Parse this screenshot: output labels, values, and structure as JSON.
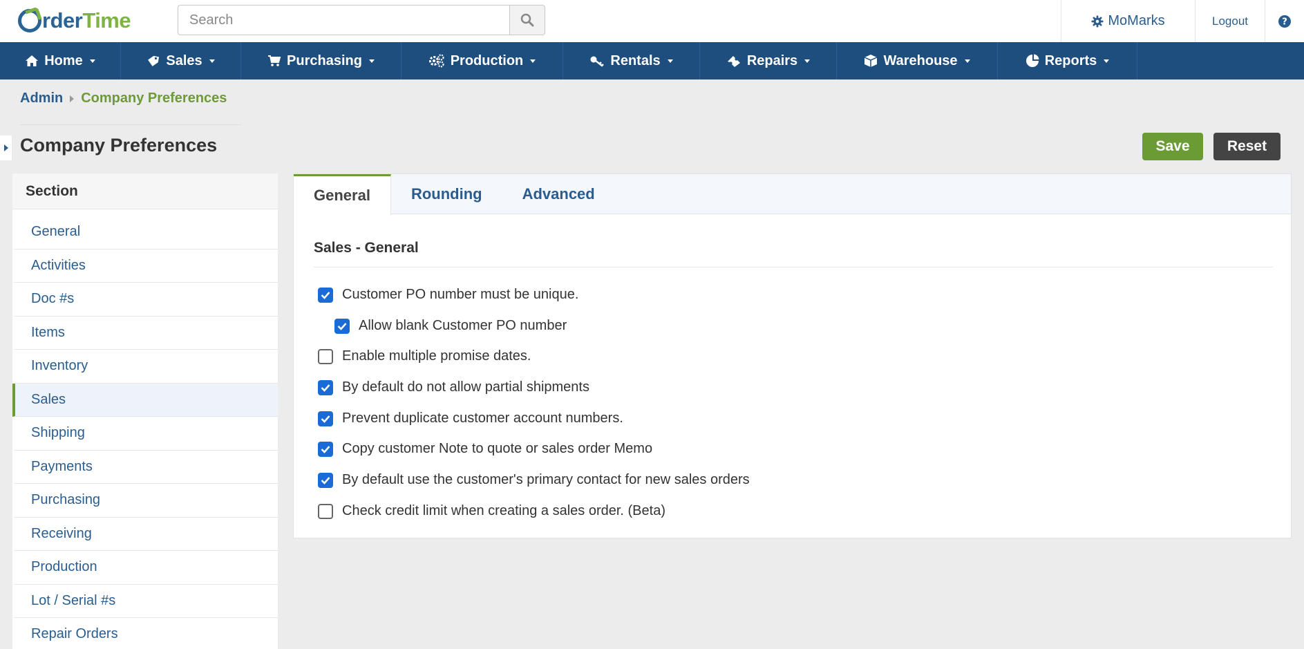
{
  "header": {
    "logo_part1": "O",
    "logo_part2": "rder",
    "logo_part3": "Time",
    "search_placeholder": "Search",
    "user_label": "MoMarks",
    "logout_label": "Logout"
  },
  "nav": [
    {
      "label": "Home",
      "icon": "home-icon"
    },
    {
      "label": "Sales",
      "icon": "tag-icon"
    },
    {
      "label": "Purchasing",
      "icon": "cart-icon"
    },
    {
      "label": "Production",
      "icon": "gears-icon"
    },
    {
      "label": "Rentals",
      "icon": "key-icon"
    },
    {
      "label": "Repairs",
      "icon": "ticket-icon"
    },
    {
      "label": "Warehouse",
      "icon": "box-icon"
    },
    {
      "label": "Reports",
      "icon": "pie-chart-icon"
    }
  ],
  "breadcrumb": {
    "root": "Admin",
    "current": "Company Preferences"
  },
  "page": {
    "title": "Company Preferences",
    "save_label": "Save",
    "reset_label": "Reset"
  },
  "sidebar": {
    "heading": "Section",
    "items": [
      "General",
      "Activities",
      "Doc #s",
      "Items",
      "Inventory",
      "Sales",
      "Shipping",
      "Payments",
      "Purchasing",
      "Receiving",
      "Production",
      "Lot / Serial #s",
      "Repair Orders"
    ],
    "active": "Sales"
  },
  "tabs": [
    "General",
    "Rounding",
    "Advanced"
  ],
  "section": {
    "title": "Sales - General",
    "options": [
      {
        "label": "Customer PO number must be unique.",
        "checked": true
      },
      {
        "label": "Allow blank Customer PO number",
        "checked": true
      },
      {
        "label": "Enable multiple promise dates.",
        "checked": false
      },
      {
        "label": "By default do not allow partial shipments",
        "checked": true
      },
      {
        "label": "Prevent duplicate customer account numbers.",
        "checked": true
      },
      {
        "label": "Copy customer Note to quote or sales order Memo",
        "checked": true
      },
      {
        "label": "By default use the customer's primary contact for new sales orders",
        "checked": true
      },
      {
        "label": "Check credit limit when creating a sales order. (Beta)",
        "checked": false
      }
    ]
  },
  "colors": {
    "nav_bg": "#1e4e7e",
    "accent_green": "#6a9b34",
    "link_blue": "#2a5d8f",
    "checkbox_blue": "#1a6bd6"
  }
}
